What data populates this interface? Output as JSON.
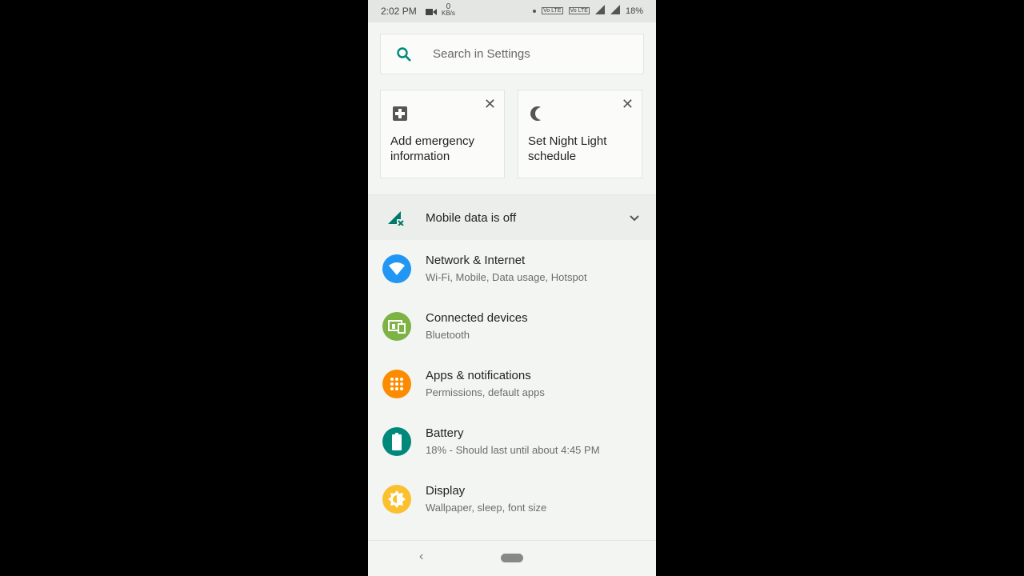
{
  "status_bar": {
    "time": "2:02 PM",
    "speed_value": "0",
    "speed_unit": "KB/s",
    "volte1": "Vo LTE",
    "volte2": "Vo LTE",
    "battery": "18%"
  },
  "search": {
    "placeholder": "Search in Settings",
    "icon": "search-icon",
    "accent_color": "#00897b"
  },
  "suggestions": [
    {
      "label": "Add emergency information",
      "icon": "medical-plus-icon",
      "close_icon": "close-icon"
    },
    {
      "label": "Set Night Light schedule",
      "icon": "moon-icon",
      "close_icon": "close-icon"
    }
  ],
  "condition": {
    "title": "Mobile data is off",
    "icon": "mobile-data-off-icon",
    "expand_icon": "chevron-down-icon"
  },
  "settings": [
    {
      "title": "Network & Internet",
      "subtitle": "Wi-Fi, Mobile, Data usage, Hotspot",
      "icon": "wifi-icon",
      "color": "#2196f3"
    },
    {
      "title": "Connected devices",
      "subtitle": "Bluetooth",
      "icon": "devices-icon",
      "color": "#7cb342"
    },
    {
      "title": "Apps & notifications",
      "subtitle": "Permissions, default apps",
      "icon": "apps-grid-icon",
      "color": "#fb8c00"
    },
    {
      "title": "Battery",
      "subtitle": "18% - Should last until about 4:45 PM",
      "icon": "battery-icon",
      "color": "#00897b"
    },
    {
      "title": "Display",
      "subtitle": "Wallpaper, sleep, font size",
      "icon": "brightness-icon",
      "color": "#fbc02d"
    }
  ],
  "nav": {
    "back_icon": "back-icon",
    "home_icon": "home-pill-icon",
    "back_glyph": "‹"
  }
}
